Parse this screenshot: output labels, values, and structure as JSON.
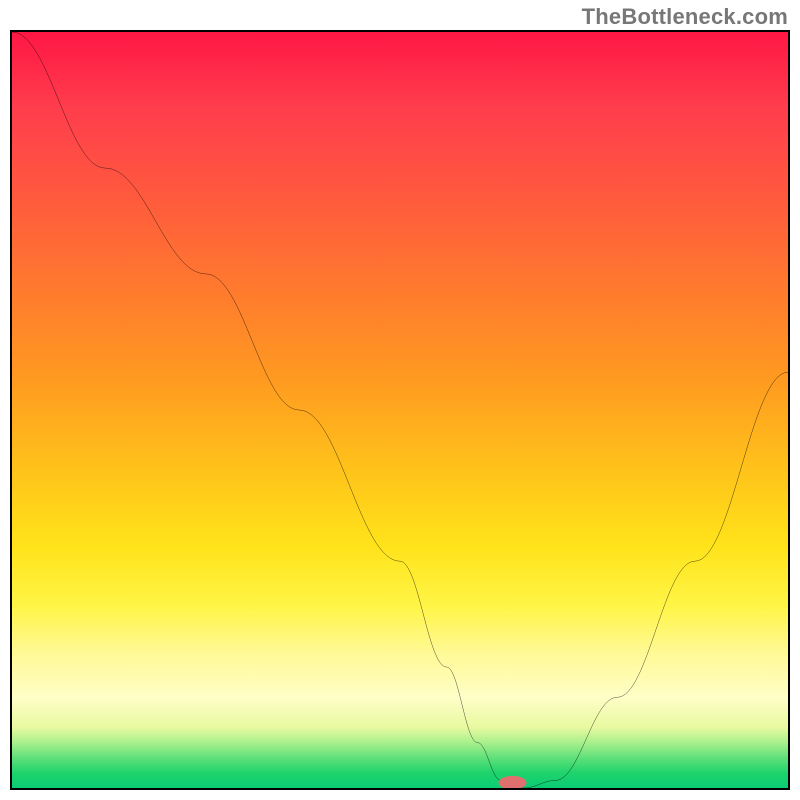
{
  "watermark": "TheBottleneck.com",
  "chart_data": {
    "type": "line",
    "title": "",
    "xlabel": "",
    "ylabel": "",
    "xlim": [
      0,
      100
    ],
    "ylim": [
      0,
      100
    ],
    "annotations": [],
    "series": [
      {
        "name": "bottleneck-curve",
        "x": [
          0,
          12,
          25,
          37,
          50,
          56,
          60,
          63,
          66,
          70,
          78,
          88,
          100
        ],
        "values": [
          100,
          82,
          68,
          50,
          30,
          16,
          6,
          1,
          0,
          1,
          12,
          30,
          55
        ]
      }
    ],
    "marker": {
      "x": 64.5,
      "y": 0,
      "color": "#e0706e"
    },
    "background_gradient": {
      "stops": [
        {
          "pos": 0,
          "color": "#ff1744"
        },
        {
          "pos": 40,
          "color": "#ff8a20"
        },
        {
          "pos": 70,
          "color": "#ffe31a"
        },
        {
          "pos": 90,
          "color": "#fffec7"
        },
        {
          "pos": 100,
          "color": "#0acc75"
        }
      ]
    }
  }
}
